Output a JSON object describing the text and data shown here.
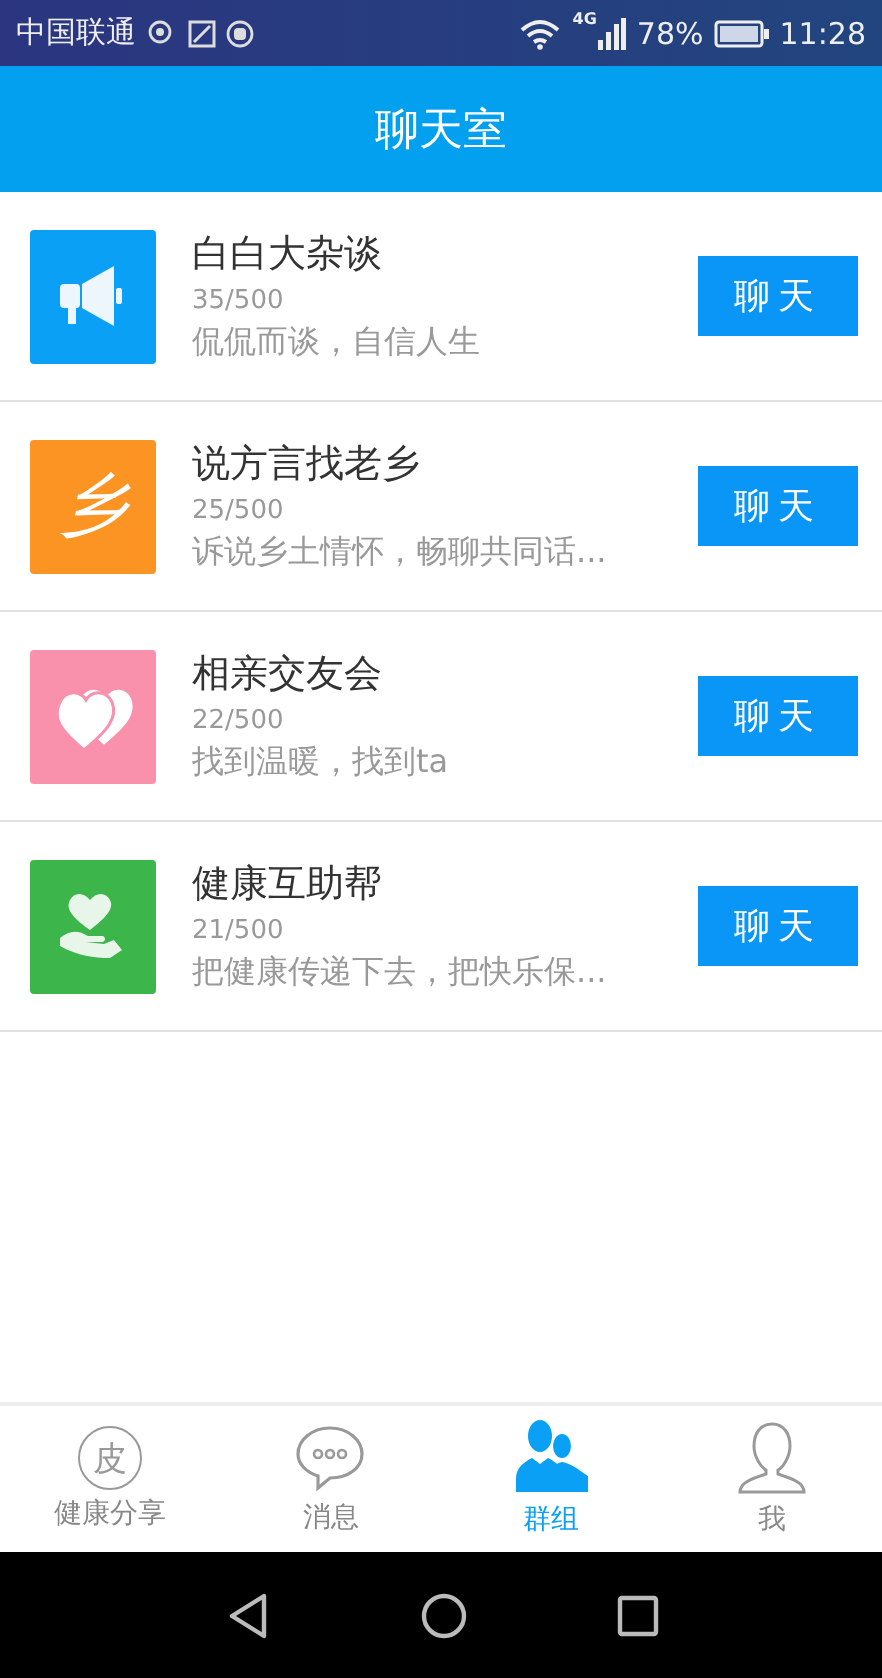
{
  "status_bar": {
    "carrier": "中国联通",
    "network": "4G",
    "battery": "78%",
    "time": "11:28"
  },
  "header": {
    "title": "聊天室"
  },
  "rooms": [
    {
      "name": "白白大杂谈",
      "count": "35/500",
      "desc": "侃侃而谈，自信人生",
      "icon": {
        "kind": "megaphone",
        "color": "#0aa0f5"
      },
      "button": "聊天"
    },
    {
      "name": "说方言找老乡",
      "count": "25/500",
      "desc": "诉说乡土情怀，畅聊共同话...",
      "icon": {
        "kind": "glyph",
        "glyph": "乡",
        "color": "#fb9422"
      },
      "button": "聊天"
    },
    {
      "name": "相亲交友会",
      "count": "22/500",
      "desc": "找到温暖，找到ta",
      "icon": {
        "kind": "hearts",
        "color": "#f991ad"
      },
      "button": "聊天"
    },
    {
      "name": "健康互助帮",
      "count": "21/500",
      "desc": "把健康传递下去，把快乐保...",
      "icon": {
        "kind": "hand-heart",
        "color": "#3cb54a"
      },
      "button": "聊天"
    }
  ],
  "tabs": [
    {
      "label": "健康分享",
      "kind": "glyph",
      "glyph": "皮",
      "selected": false
    },
    {
      "label": "消息",
      "kind": "bubble",
      "selected": false
    },
    {
      "label": "群组",
      "kind": "group",
      "selected": true
    },
    {
      "label": "我",
      "kind": "person",
      "selected": false
    }
  ]
}
